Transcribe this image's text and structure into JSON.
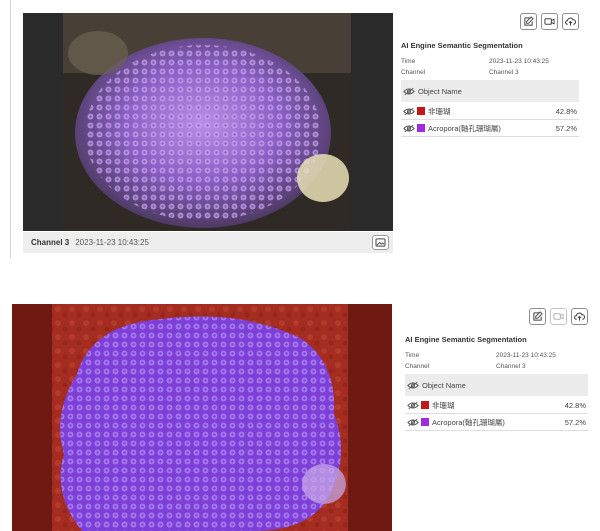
{
  "panel_top": {
    "caption": {
      "channel": "Channel 3",
      "timestamp": "2023-11-23 10:43:25"
    },
    "info": {
      "title": "AI Engine Semantic Segmentation",
      "time_label": "Time",
      "time_value": "2023-11-23 10:43:25",
      "channel_label": "Channel",
      "channel_value": "Channel 3",
      "object_header": "Object Name",
      "objects": [
        {
          "name": "非珊瑚",
          "percent": "42.8%",
          "color": "#c41717"
        },
        {
          "name": "Acropora(軸孔珊瑚屬)",
          "percent": "57.2%",
          "color": "#9b2ce0"
        }
      ]
    }
  },
  "panel_bottom": {
    "info": {
      "title": "AI Engine Semantic Segmentation",
      "time_label": "Time",
      "time_value": "2023-11-23 10:43:25",
      "channel_label": "Channel",
      "channel_value": "Channel 3",
      "object_header": "Object Name",
      "objects": [
        {
          "name": "非珊瑚",
          "percent": "42.8%",
          "color": "#c41717"
        },
        {
          "name": "Acropora(軸孔珊瑚屬)",
          "percent": "57.2%",
          "color": "#9b2ce0"
        }
      ]
    }
  },
  "icons": {
    "toolbar": [
      "annotate-icon",
      "video-icon",
      "cloud-upload-icon"
    ],
    "caption": "image-icon",
    "row": "eye-icon"
  }
}
